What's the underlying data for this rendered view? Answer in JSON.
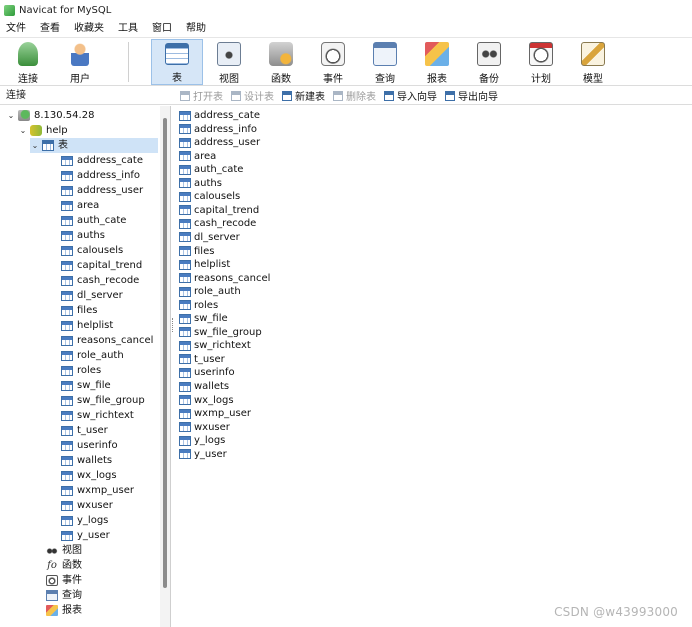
{
  "window": {
    "title": "Navicat for MySQL"
  },
  "menubar": {
    "items": [
      "文件",
      "查看",
      "收藏夹",
      "工具",
      "窗口",
      "帮助"
    ]
  },
  "toolbar": {
    "items": [
      {
        "label": "连接",
        "icon": "connection-icon"
      },
      {
        "label": "用户",
        "icon": "user-icon"
      },
      {
        "label": "表",
        "icon": "table-icon",
        "active": true
      },
      {
        "label": "视图",
        "icon": "view-icon"
      },
      {
        "label": "函数",
        "icon": "function-icon"
      },
      {
        "label": "事件",
        "icon": "event-icon"
      },
      {
        "label": "查询",
        "icon": "query-icon"
      },
      {
        "label": "报表",
        "icon": "report-icon"
      },
      {
        "label": "备份",
        "icon": "backup-icon"
      },
      {
        "label": "计划",
        "icon": "schedule-icon"
      },
      {
        "label": "模型",
        "icon": "model-icon"
      }
    ]
  },
  "left_header": {
    "label": "连接"
  },
  "object_toolbar": {
    "items": [
      {
        "label": "打开表",
        "enabled": false
      },
      {
        "label": "设计表",
        "enabled": false
      },
      {
        "label": "新建表",
        "enabled": true
      },
      {
        "label": "删除表",
        "enabled": false
      },
      {
        "label": "导入向导",
        "enabled": true
      },
      {
        "label": "导出向导",
        "enabled": true
      }
    ]
  },
  "tree": {
    "server": "8.130.54.28",
    "database": "help",
    "table_group": "表",
    "tables": [
      "address_cate",
      "address_info",
      "address_user",
      "area",
      "auth_cate",
      "auths",
      "calousels",
      "capital_trend",
      "cash_recode",
      "dl_server",
      "files",
      "helplist",
      "reasons_cancel",
      "role_auth",
      "roles",
      "sw_file",
      "sw_file_group",
      "sw_richtext",
      "t_user",
      "userinfo",
      "wallets",
      "wx_logs",
      "wxmp_user",
      "wxuser",
      "y_logs",
      "y_user"
    ],
    "other_nodes": [
      {
        "label": "视图",
        "icon": "view-glasses-icon"
      },
      {
        "label": "函数",
        "icon": "function-icon"
      },
      {
        "label": "事件",
        "icon": "event-icon"
      },
      {
        "label": "查询",
        "icon": "query-icon"
      },
      {
        "label": "报表",
        "icon": "report-icon"
      }
    ]
  },
  "main_list": {
    "items": [
      "address_cate",
      "address_info",
      "address_user",
      "area",
      "auth_cate",
      "auths",
      "calousels",
      "capital_trend",
      "cash_recode",
      "dl_server",
      "files",
      "helplist",
      "reasons_cancel",
      "role_auth",
      "roles",
      "sw_file",
      "sw_file_group",
      "sw_richtext",
      "t_user",
      "userinfo",
      "wallets",
      "wx_logs",
      "wxmp_user",
      "wxuser",
      "y_logs",
      "y_user"
    ]
  },
  "watermark": "CSDN @w43993000"
}
